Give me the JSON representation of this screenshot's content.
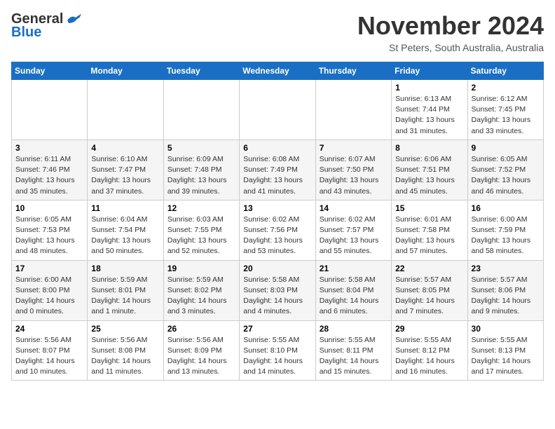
{
  "header": {
    "logo_line1": "General",
    "logo_line2": "Blue",
    "month": "November 2024",
    "location": "St Peters, South Australia, Australia"
  },
  "weekdays": [
    "Sunday",
    "Monday",
    "Tuesday",
    "Wednesday",
    "Thursday",
    "Friday",
    "Saturday"
  ],
  "weeks": [
    [
      {
        "day": "",
        "info": ""
      },
      {
        "day": "",
        "info": ""
      },
      {
        "day": "",
        "info": ""
      },
      {
        "day": "",
        "info": ""
      },
      {
        "day": "",
        "info": ""
      },
      {
        "day": "1",
        "info": "Sunrise: 6:13 AM\nSunset: 7:44 PM\nDaylight: 13 hours\nand 31 minutes."
      },
      {
        "day": "2",
        "info": "Sunrise: 6:12 AM\nSunset: 7:45 PM\nDaylight: 13 hours\nand 33 minutes."
      }
    ],
    [
      {
        "day": "3",
        "info": "Sunrise: 6:11 AM\nSunset: 7:46 PM\nDaylight: 13 hours\nand 35 minutes."
      },
      {
        "day": "4",
        "info": "Sunrise: 6:10 AM\nSunset: 7:47 PM\nDaylight: 13 hours\nand 37 minutes."
      },
      {
        "day": "5",
        "info": "Sunrise: 6:09 AM\nSunset: 7:48 PM\nDaylight: 13 hours\nand 39 minutes."
      },
      {
        "day": "6",
        "info": "Sunrise: 6:08 AM\nSunset: 7:49 PM\nDaylight: 13 hours\nand 41 minutes."
      },
      {
        "day": "7",
        "info": "Sunrise: 6:07 AM\nSunset: 7:50 PM\nDaylight: 13 hours\nand 43 minutes."
      },
      {
        "day": "8",
        "info": "Sunrise: 6:06 AM\nSunset: 7:51 PM\nDaylight: 13 hours\nand 45 minutes."
      },
      {
        "day": "9",
        "info": "Sunrise: 6:05 AM\nSunset: 7:52 PM\nDaylight: 13 hours\nand 46 minutes."
      }
    ],
    [
      {
        "day": "10",
        "info": "Sunrise: 6:05 AM\nSunset: 7:53 PM\nDaylight: 13 hours\nand 48 minutes."
      },
      {
        "day": "11",
        "info": "Sunrise: 6:04 AM\nSunset: 7:54 PM\nDaylight: 13 hours\nand 50 minutes."
      },
      {
        "day": "12",
        "info": "Sunrise: 6:03 AM\nSunset: 7:55 PM\nDaylight: 13 hours\nand 52 minutes."
      },
      {
        "day": "13",
        "info": "Sunrise: 6:02 AM\nSunset: 7:56 PM\nDaylight: 13 hours\nand 53 minutes."
      },
      {
        "day": "14",
        "info": "Sunrise: 6:02 AM\nSunset: 7:57 PM\nDaylight: 13 hours\nand 55 minutes."
      },
      {
        "day": "15",
        "info": "Sunrise: 6:01 AM\nSunset: 7:58 PM\nDaylight: 13 hours\nand 57 minutes."
      },
      {
        "day": "16",
        "info": "Sunrise: 6:00 AM\nSunset: 7:59 PM\nDaylight: 13 hours\nand 58 minutes."
      }
    ],
    [
      {
        "day": "17",
        "info": "Sunrise: 6:00 AM\nSunset: 8:00 PM\nDaylight: 14 hours\nand 0 minutes."
      },
      {
        "day": "18",
        "info": "Sunrise: 5:59 AM\nSunset: 8:01 PM\nDaylight: 14 hours\nand 1 minute."
      },
      {
        "day": "19",
        "info": "Sunrise: 5:59 AM\nSunset: 8:02 PM\nDaylight: 14 hours\nand 3 minutes."
      },
      {
        "day": "20",
        "info": "Sunrise: 5:58 AM\nSunset: 8:03 PM\nDaylight: 14 hours\nand 4 minutes."
      },
      {
        "day": "21",
        "info": "Sunrise: 5:58 AM\nSunset: 8:04 PM\nDaylight: 14 hours\nand 6 minutes."
      },
      {
        "day": "22",
        "info": "Sunrise: 5:57 AM\nSunset: 8:05 PM\nDaylight: 14 hours\nand 7 minutes."
      },
      {
        "day": "23",
        "info": "Sunrise: 5:57 AM\nSunset: 8:06 PM\nDaylight: 14 hours\nand 9 minutes."
      }
    ],
    [
      {
        "day": "24",
        "info": "Sunrise: 5:56 AM\nSunset: 8:07 PM\nDaylight: 14 hours\nand 10 minutes."
      },
      {
        "day": "25",
        "info": "Sunrise: 5:56 AM\nSunset: 8:08 PM\nDaylight: 14 hours\nand 11 minutes."
      },
      {
        "day": "26",
        "info": "Sunrise: 5:56 AM\nSunset: 8:09 PM\nDaylight: 14 hours\nand 13 minutes."
      },
      {
        "day": "27",
        "info": "Sunrise: 5:55 AM\nSunset: 8:10 PM\nDaylight: 14 hours\nand 14 minutes."
      },
      {
        "day": "28",
        "info": "Sunrise: 5:55 AM\nSunset: 8:11 PM\nDaylight: 14 hours\nand 15 minutes."
      },
      {
        "day": "29",
        "info": "Sunrise: 5:55 AM\nSunset: 8:12 PM\nDaylight: 14 hours\nand 16 minutes."
      },
      {
        "day": "30",
        "info": "Sunrise: 5:55 AM\nSunset: 8:13 PM\nDaylight: 14 hours\nand 17 minutes."
      }
    ]
  ]
}
